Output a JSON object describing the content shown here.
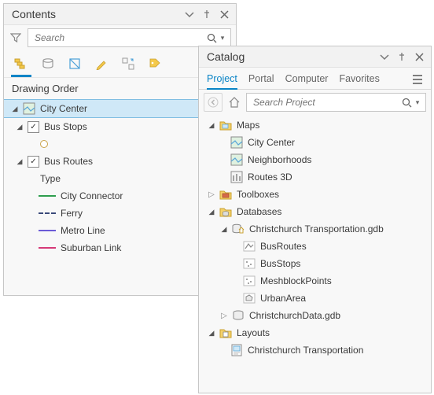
{
  "contents": {
    "title": "Contents",
    "search_placeholder": "Search",
    "section_header": "Drawing Order",
    "tree": {
      "city_center": "City Center",
      "bus_stops": "Bus Stops",
      "bus_routes": "Bus Routes",
      "type_label": "Type",
      "connector": "City Connector",
      "ferry": "Ferry",
      "metro": "Metro Line",
      "suburban": "Suburban Link"
    }
  },
  "catalog": {
    "title": "Catalog",
    "tabs": {
      "project": "Project",
      "portal": "Portal",
      "computer": "Computer",
      "favorites": "Favorites"
    },
    "search_placeholder": "Search Project",
    "tree": {
      "maps": "Maps",
      "city_center": "City Center",
      "neighborhoods": "Neighborhoods",
      "routes3d": "Routes 3D",
      "toolboxes": "Toolboxes",
      "databases": "Databases",
      "gdb1": "Christchurch Transportation.gdb",
      "bus_routes": "BusRoutes",
      "bus_stops": "BusStops",
      "meshblock": "MeshblockPoints",
      "urban": "UrbanArea",
      "gdb2": "ChristchurchData.gdb",
      "layouts": "Layouts",
      "layout1": "Christchurch Transportation"
    }
  },
  "legend_colors": {
    "connector": "#2e9e4e",
    "ferry": "#3a4a7a",
    "metro": "#6a5ad6",
    "suburban": "#d63a78"
  }
}
